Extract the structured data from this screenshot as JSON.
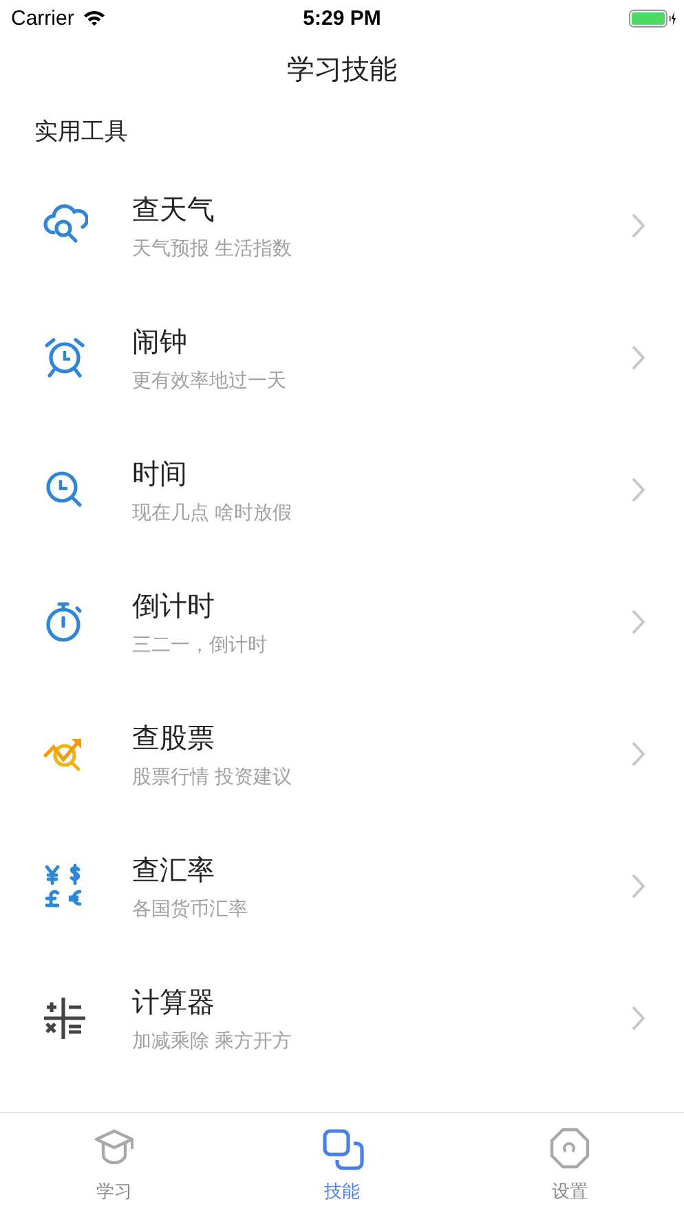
{
  "status_bar": {
    "carrier": "Carrier",
    "time": "5:29 PM"
  },
  "nav": {
    "title": "学习技能"
  },
  "section": {
    "title": "实用工具"
  },
  "items": [
    {
      "title": "查天气",
      "subtitle": "天气预报 生活指数"
    },
    {
      "title": "闹钟",
      "subtitle": "更有效率地过一天"
    },
    {
      "title": "时间",
      "subtitle": "现在几点 啥时放假"
    },
    {
      "title": "倒计时",
      "subtitle": "三二一，倒计时"
    },
    {
      "title": "查股票",
      "subtitle": "股票行情 投资建议"
    },
    {
      "title": "查汇率",
      "subtitle": "各国货币汇率"
    },
    {
      "title": "计算器",
      "subtitle": "加减乘除 乘方开方"
    }
  ],
  "tabs": [
    {
      "label": "学习",
      "selected": false
    },
    {
      "label": "技能",
      "selected": true
    },
    {
      "label": "设置",
      "selected": false
    }
  ]
}
